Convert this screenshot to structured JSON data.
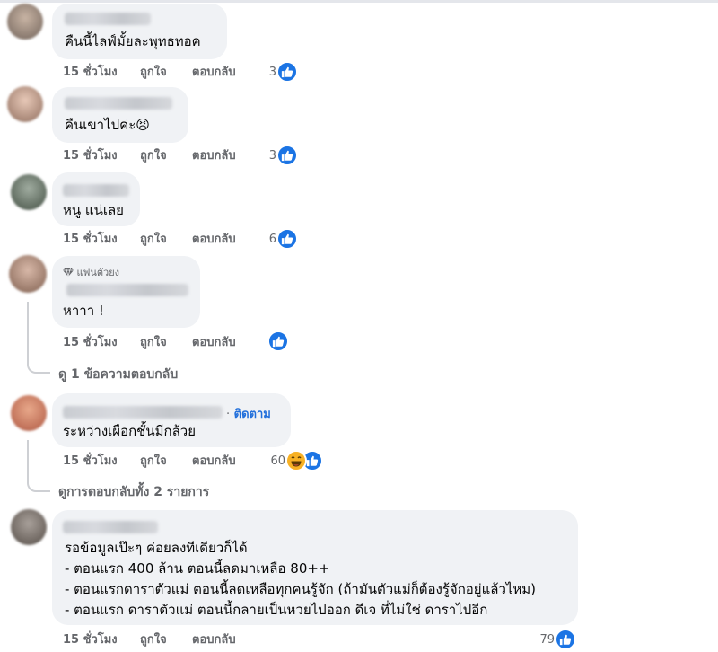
{
  "comments": [
    {
      "text": "คืนนี้ไลฟ์มั้ยละพุทธทอค",
      "time": "15 ชั่วโมง",
      "like": "ถูกใจ",
      "reply": "ตอบกลับ",
      "reactions": "3"
    },
    {
      "text": "คืนเขาไปค่ะ😣",
      "time": "15 ชั่วโมง",
      "like": "ถูกใจ",
      "reply": "ตอบกลับ",
      "reactions": "3"
    },
    {
      "text": "หนู แน่เลย",
      "time": "15 ชั่วโมง",
      "like": "ถูกใจ",
      "reply": "ตอบกลับ",
      "reactions": "6"
    },
    {
      "badge": "แฟนตัวยง",
      "text": "หาาา !",
      "time": "15 ชั่วโมง",
      "like": "ถูกใจ",
      "reply": "ตอบกลับ",
      "view_replies": "ดู 1 ข้อความตอบกลับ"
    },
    {
      "follow": "ติดตาม",
      "text": "ระหว่างเผือกชั้นมีกล้วย",
      "time": "15 ชั่วโมง",
      "like": "ถูกใจ",
      "reply": "ตอบกลับ",
      "reactions": "60",
      "view_replies": "ดูการตอบกลับทั้ง 2 รายการ"
    },
    {
      "lines": [
        "รอข้อมูลเป๊ะๆ ค่อยลงทีเดียวก็ได้",
        "- ตอนแรก 400 ล้าน ตอนนี้ลดมาเหลือ 80++",
        "- ตอนแรกดาราตัวแม่ ตอนนี้ลดเหลือทุกคนรู้จัก (ถ้ามันตัวแม่ก็ต้องรู้จักอยู่แล้วไหม)",
        "- ตอนแรก ดาราตัวแม่ ตอนนี้กลายเป็นหวยไปออก ดีเจ ที่ไม่ใช่ ดาราไปอีก"
      ],
      "time": "15 ชั่วโมง",
      "like": "ถูกใจ",
      "reply": "ตอบกลับ",
      "reactions": "79"
    }
  ],
  "colors": {
    "like": "#1b74e4",
    "bubble": "#f0f2f5",
    "meta": "#65676b",
    "link": "#216fdb"
  },
  "icons": [
    "avatar",
    "like-reaction-icon",
    "haha-reaction-icon",
    "diamond-icon"
  ]
}
